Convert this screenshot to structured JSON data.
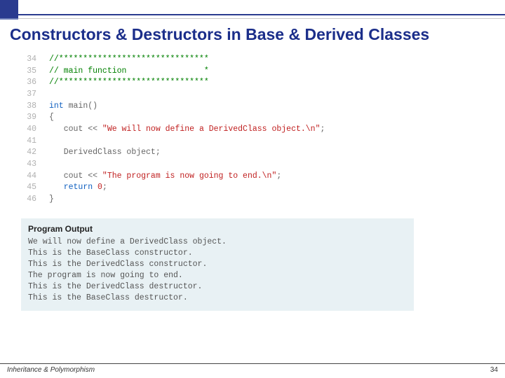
{
  "title": "Constructors & Destructors in Base & Derived Classes",
  "code": {
    "lines": [
      {
        "n": "34",
        "cls": "cmt",
        "t": "//*******************************"
      },
      {
        "n": "35",
        "cls": "cmt",
        "t": "// main function                *"
      },
      {
        "n": "36",
        "cls": "cmt",
        "t": "//*******************************"
      },
      {
        "n": "37",
        "cls": "",
        "t": ""
      },
      {
        "n": "38",
        "cls": "",
        "t": "int main()"
      },
      {
        "n": "39",
        "cls": "",
        "t": "{"
      },
      {
        "n": "40",
        "cls": "",
        "t": "   cout << \"We will now define a DerivedClass object.\\n\";"
      },
      {
        "n": "41",
        "cls": "",
        "t": ""
      },
      {
        "n": "42",
        "cls": "",
        "t": "   DerivedClass object;"
      },
      {
        "n": "43",
        "cls": "",
        "t": ""
      },
      {
        "n": "44",
        "cls": "",
        "t": "   cout << \"The program is now going to end.\\n\";"
      },
      {
        "n": "45",
        "cls": "",
        "t": "   return 0;"
      },
      {
        "n": "46",
        "cls": "",
        "t": "}"
      }
    ]
  },
  "output": {
    "heading": "Program Output",
    "lines": [
      "We will now define a DerivedClass object.",
      "This is the BaseClass constructor.",
      "This is the DerivedClass constructor.",
      "The program is now going to end.",
      "This is the DerivedClass destructor.",
      "This is the BaseClass destructor."
    ]
  },
  "footer": {
    "left": "Inheritance & Polymorphism",
    "page": "34"
  }
}
